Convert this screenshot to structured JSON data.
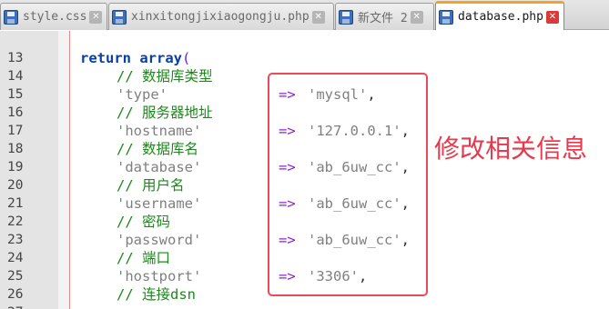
{
  "tabs": [
    {
      "label": "style.css",
      "active": false,
      "icon": "save-icon"
    },
    {
      "label": "xinxitongjixiaogongju.php",
      "active": false,
      "icon": "save-icon"
    },
    {
      "label": "新文件  2",
      "active": false,
      "icon": "save-icon"
    },
    {
      "label": "database.php",
      "active": true,
      "icon": "save-icon"
    }
  ],
  "close_glyph": "✕",
  "editor": {
    "lines": [
      {
        "num": "13",
        "type": "blank"
      },
      {
        "num": "14",
        "type": "return",
        "keyword": "return array",
        "paren": "("
      },
      {
        "num": "15",
        "type": "comment",
        "text": "// 数据库类型"
      },
      {
        "num": "16",
        "type": "entry",
        "key": "'type'",
        "arrow": "=>",
        "value": "'mysql'",
        "comma": ","
      },
      {
        "num": "17",
        "type": "comment",
        "text": "// 服务器地址"
      },
      {
        "num": "18",
        "type": "entry",
        "key": "'hostname'",
        "arrow": "=>",
        "value": "'127.0.0.1'",
        "comma": ","
      },
      {
        "num": "19",
        "type": "comment",
        "text": "// 数据库名"
      },
      {
        "num": "20",
        "type": "entry",
        "key": "'database'",
        "arrow": "=>",
        "value": "'ab_6uw_cc'",
        "comma": ","
      },
      {
        "num": "21",
        "type": "comment",
        "text": "// 用户名"
      },
      {
        "num": "22",
        "type": "entry",
        "key": "'username'",
        "arrow": "=>",
        "value": "'ab_6uw_cc'",
        "comma": ","
      },
      {
        "num": "23",
        "type": "comment",
        "text": "// 密码"
      },
      {
        "num": "24",
        "type": "entry",
        "key": "'password'",
        "arrow": "=>",
        "value": "'ab_6uw_cc'",
        "comma": ","
      },
      {
        "num": "25",
        "type": "comment",
        "text": "// 端口"
      },
      {
        "num": "26",
        "type": "entry",
        "key": "'hostport'",
        "arrow": "=>",
        "value": "'3306'",
        "comma": ","
      },
      {
        "num": "27",
        "type": "comment",
        "text": "// 连接dsn"
      }
    ]
  },
  "annotation": {
    "text": "修改相关信息",
    "color": "#e63a4c"
  },
  "colors": {
    "active_tab_accent": "#f4a328",
    "keyword": "#0a3ea5",
    "comment": "#1b8a1b",
    "string": "#808080",
    "operator": "#8b1fd8",
    "highlight_border": "#ea4a5a"
  }
}
